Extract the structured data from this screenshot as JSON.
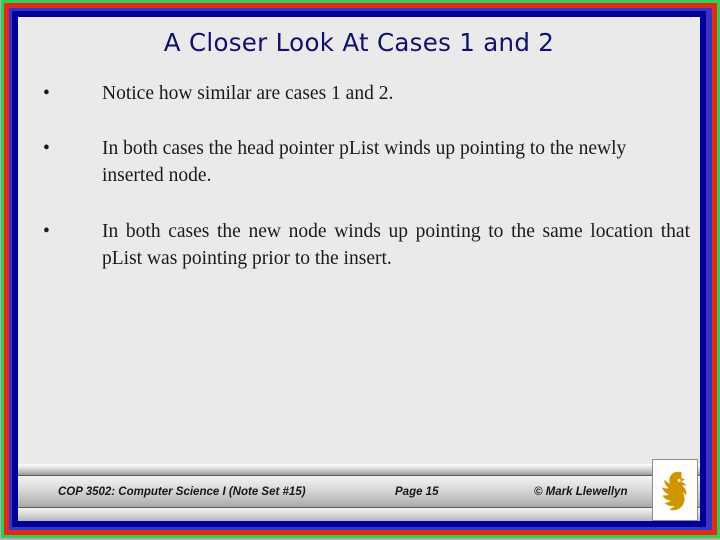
{
  "slide": {
    "title": "A Closer Look At Cases 1 and 2",
    "bullets": [
      {
        "marker": "•",
        "text": "Notice how similar are cases 1 and 2.",
        "justified": false
      },
      {
        "marker": "•",
        "text": "In both cases the head pointer pList winds up pointing to the newly inserted node.",
        "justified": false
      },
      {
        "marker": "•",
        "text": "In both cases the new node winds up pointing to the same location that pList was pointing prior to the insert.",
        "justified": true
      }
    ]
  },
  "footer": {
    "course": "COP 3502: Computer Science I  (Note Set #15)",
    "page": "Page 15",
    "copyright": "© Mark Llewellyn",
    "logo_name": "ucf-pegasus-logo"
  },
  "colors": {
    "border_green": "#33cc55",
    "border_red": "#e02b18",
    "border_blue_mid": "#3535c7",
    "border_navy": "#000099",
    "canvas_bg": "#eaeaea",
    "title_color": "#10106e",
    "body_color": "#1a1a1a",
    "logo_gold": "#cf9400"
  }
}
